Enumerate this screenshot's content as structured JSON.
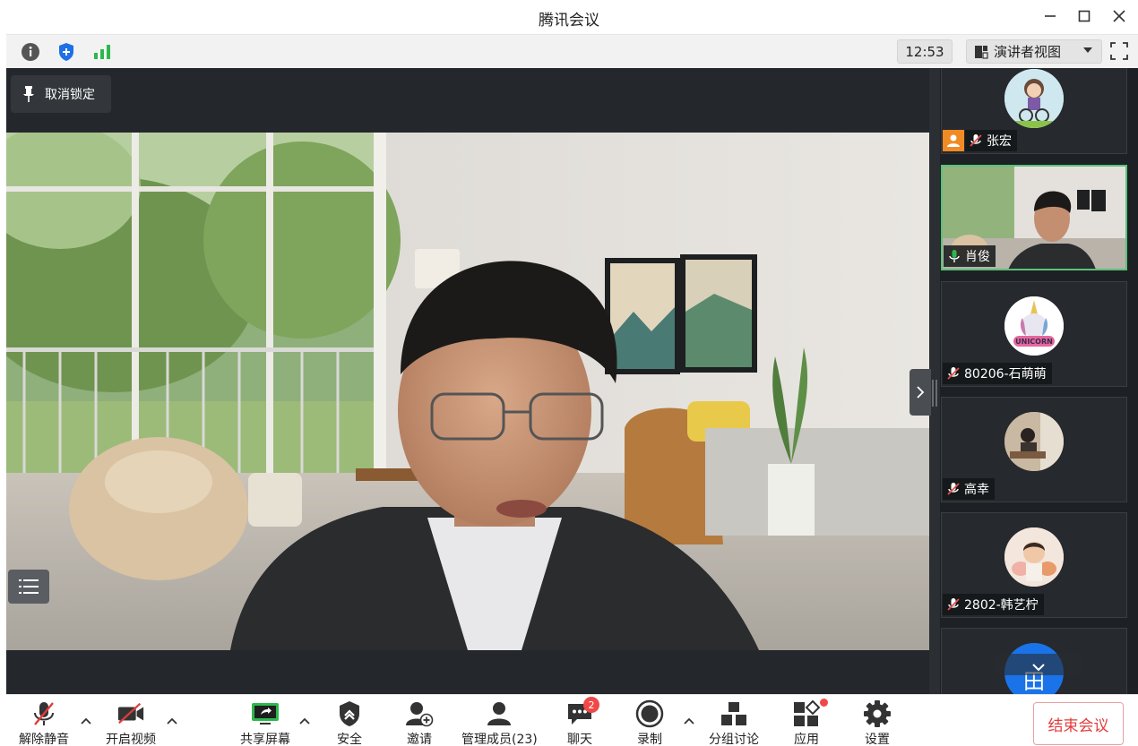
{
  "window": {
    "title": "腾讯会议"
  },
  "infobar": {
    "clock": "12:53",
    "view_mode": "演讲者视图"
  },
  "main": {
    "unpin_label": "取消锁定"
  },
  "participants": [
    {
      "name": "张宏",
      "muted": true,
      "is_host": true,
      "avatar": "cartoon-cyclist"
    },
    {
      "name": "肖俊",
      "muted": false,
      "active_speaker": true,
      "avatar": "video"
    },
    {
      "name": "80206-石萌萌",
      "muted": true,
      "avatar": "unicorn",
      "avatar_text": "UNICORN"
    },
    {
      "name": "高幸",
      "muted": true,
      "avatar": "photo-room"
    },
    {
      "name": "2802-韩艺柠",
      "muted": true,
      "avatar": "photo-child"
    },
    {
      "name": "田",
      "muted": true,
      "avatar": "initials"
    }
  ],
  "toolbar": {
    "unmute": "解除静音",
    "start_video": "开启视频",
    "share_screen": "共享屏幕",
    "security": "安全",
    "invite": "邀请",
    "manage_members": "管理成员(23)",
    "chat": "聊天",
    "chat_badge": "2",
    "record": "录制",
    "breakout": "分组讨论",
    "apps": "应用",
    "settings": "设置",
    "end_meeting": "结束会议"
  },
  "colors": {
    "accent_green": "#2db84d",
    "danger_red": "#e23b3b",
    "host_orange": "#f08a24",
    "dark_bg": "#24282c"
  }
}
